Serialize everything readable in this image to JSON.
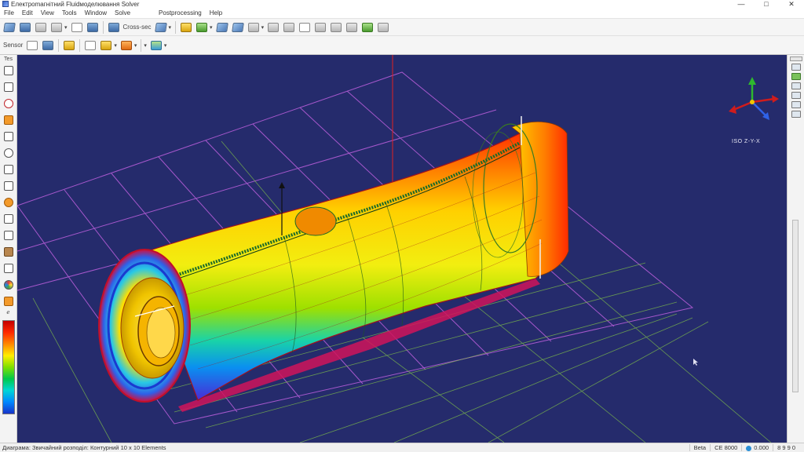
{
  "window": {
    "title": "Електроmагнітний Fluidмоделювання Solver",
    "minimize": "—",
    "maximize": "□",
    "close": "✕"
  },
  "menu": [
    "File",
    "Edit",
    "View",
    "Tools",
    "Window",
    "Solve",
    "Postprocessing",
    "Help"
  ],
  "toolbar1": {
    "combo_label": "Cross-sec",
    "icons": [
      "save-icon",
      "open-icon",
      "new-icon",
      "print-icon",
      "select-icon",
      "copy-icon",
      "view-icon",
      "zoom-icon",
      "mesh-icon",
      "solid-icon",
      "wire-icon",
      "model-icon",
      "body-icon",
      "surface-icon",
      "edge-icon",
      "vertex-icon",
      "face-icon",
      "layer-icon",
      "probe-icon",
      "measure-icon"
    ]
  },
  "toolbar2": {
    "label": "Sensor"
  },
  "left_toolbar": {
    "top_label": "Tes",
    "bottom_label": "ℯ"
  },
  "viewport": {
    "coord_label": "ISO Z-Y-X",
    "background": "#252b6c"
  },
  "status": {
    "left": "Диаграма: Звичайний розподіл: Контурний 10 x 10 Elements",
    "cell1": "Beta",
    "cell2": "CE 8000",
    "cell3": "0.000",
    "cell4": "8 9 9 0"
  },
  "colors": {
    "accent": "#2a8fd6",
    "grid_purple": "#b35cd6",
    "grid_green": "#7fbf4a"
  }
}
